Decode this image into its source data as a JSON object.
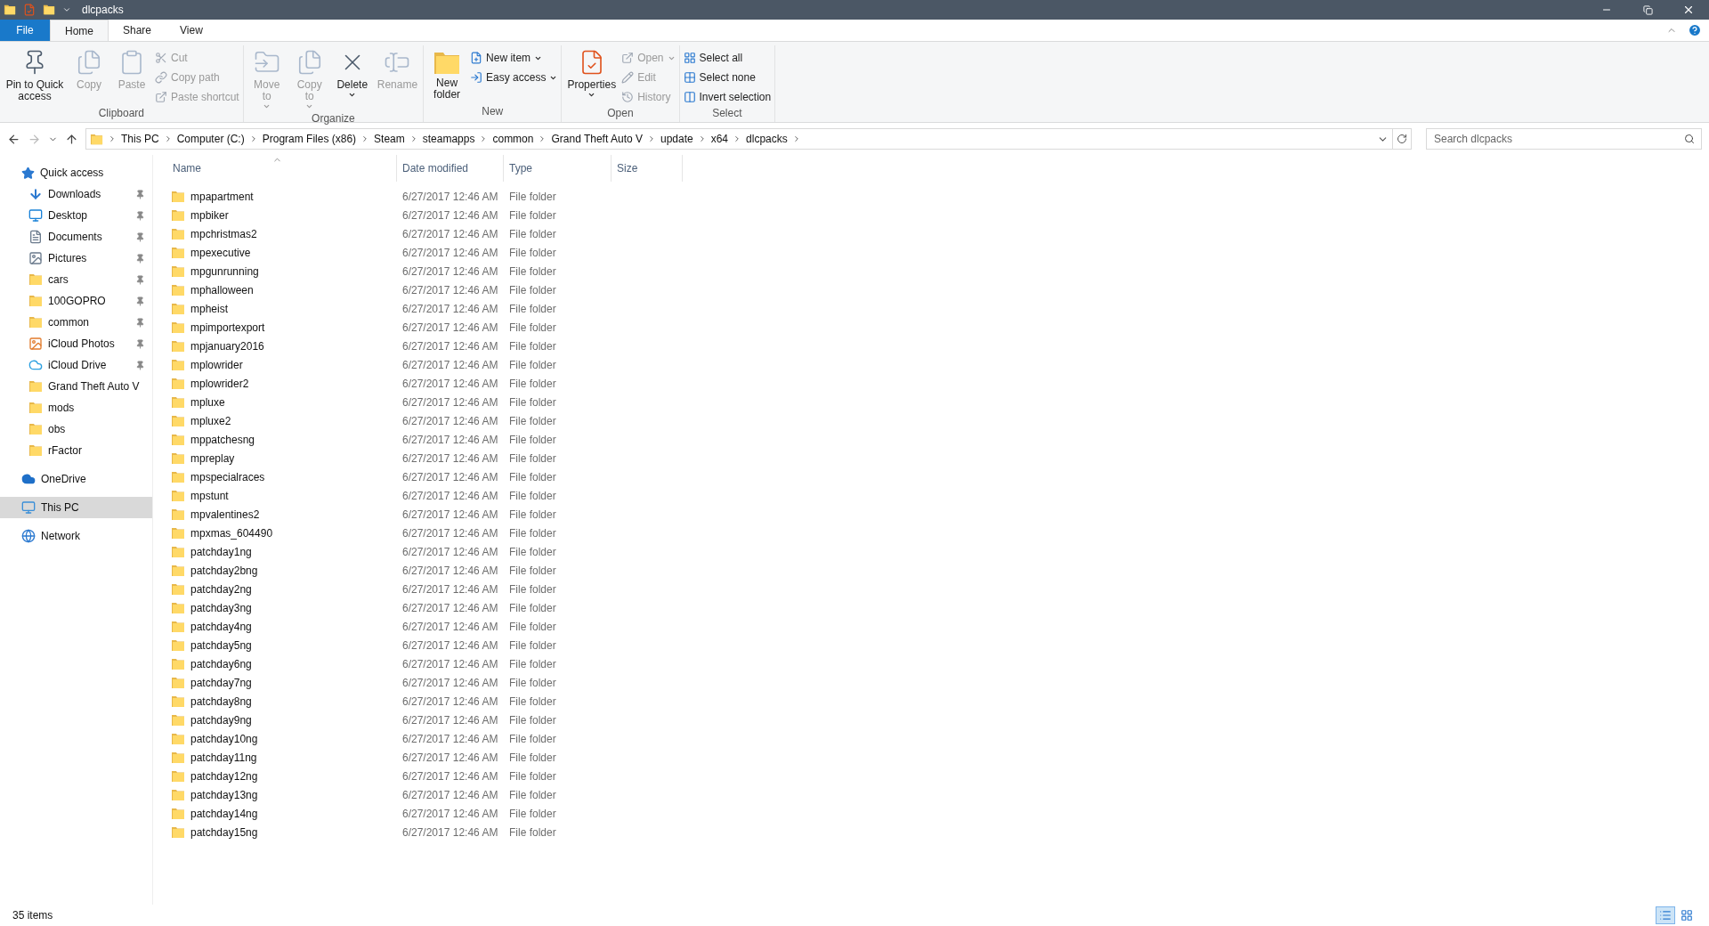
{
  "window": {
    "title": "dlcpacks"
  },
  "ribbon_tabs": [
    {
      "label": "File",
      "kind": "file",
      "selected": false
    },
    {
      "label": "Home",
      "kind": "tab",
      "selected": true
    },
    {
      "label": "Share",
      "kind": "tab",
      "selected": false
    },
    {
      "label": "View",
      "kind": "tab",
      "selected": false
    }
  ],
  "ribbon_groups": [
    {
      "label": "Clipboard",
      "buttons": [
        {
          "label": "Pin to Quick access",
          "kind": "large",
          "disabled": false,
          "dropdown": false
        },
        {
          "label": "Copy",
          "kind": "large",
          "disabled": true,
          "dropdown": false
        },
        {
          "label": "Paste",
          "kind": "large",
          "disabled": true,
          "dropdown": false
        },
        {
          "label": "Cut",
          "kind": "small",
          "disabled": true,
          "dropdown": false
        },
        {
          "label": "Copy path",
          "kind": "small",
          "disabled": true,
          "dropdown": false
        },
        {
          "label": "Paste shortcut",
          "kind": "small",
          "disabled": true,
          "dropdown": false
        }
      ]
    },
    {
      "label": "Organize",
      "buttons": [
        {
          "label": "Move to",
          "kind": "large",
          "disabled": true,
          "dropdown": true
        },
        {
          "label": "Copy to",
          "kind": "large",
          "disabled": true,
          "dropdown": true
        },
        {
          "label": "Delete",
          "kind": "large",
          "disabled": false,
          "dropdown": true
        },
        {
          "label": "Rename",
          "kind": "large",
          "disabled": true,
          "dropdown": false
        }
      ]
    },
    {
      "label": "New",
      "buttons": [
        {
          "label": "New folder",
          "kind": "large",
          "disabled": false,
          "dropdown": false
        },
        {
          "label": "New item",
          "kind": "small",
          "disabled": false,
          "dropdown": true
        },
        {
          "label": "Easy access",
          "kind": "small",
          "disabled": false,
          "dropdown": true
        }
      ]
    },
    {
      "label": "Open",
      "buttons": [
        {
          "label": "Properties",
          "kind": "large",
          "disabled": false,
          "dropdown": true
        },
        {
          "label": "Open",
          "kind": "small",
          "disabled": true,
          "dropdown": true
        },
        {
          "label": "Edit",
          "kind": "small",
          "disabled": true,
          "dropdown": false
        },
        {
          "label": "History",
          "kind": "small",
          "disabled": true,
          "dropdown": false
        }
      ]
    },
    {
      "label": "Select",
      "buttons": [
        {
          "label": "Select all",
          "kind": "small",
          "disabled": false,
          "dropdown": false
        },
        {
          "label": "Select none",
          "kind": "small",
          "disabled": false,
          "dropdown": false
        },
        {
          "label": "Invert selection",
          "kind": "small",
          "disabled": false,
          "dropdown": false
        }
      ]
    }
  ],
  "address": {
    "breadcrumbs": [
      "This PC",
      "Computer (C:)",
      "Program Files (x86)",
      "Steam",
      "steamapps",
      "common",
      "Grand Theft Auto V",
      "update",
      "x64",
      "dlcpacks"
    ],
    "search": {
      "placeholder": "Search dlcpacks"
    }
  },
  "sidebar": [
    {
      "label": "Quick access",
      "kind": "quick",
      "selected": false,
      "children": [
        {
          "label": "Downloads",
          "kind": "downloads",
          "pinned": true,
          "selected": false
        },
        {
          "label": "Desktop",
          "kind": "desktop",
          "pinned": true,
          "selected": false
        },
        {
          "label": "Documents",
          "kind": "documents",
          "pinned": true,
          "selected": false
        },
        {
          "label": "Pictures",
          "kind": "pictures",
          "pinned": true,
          "selected": false
        },
        {
          "label": "cars",
          "kind": "folder",
          "pinned": true,
          "selected": false
        },
        {
          "label": "100GOPRO",
          "kind": "folder",
          "pinned": true,
          "selected": false
        },
        {
          "label": "common",
          "kind": "folder",
          "pinned": true,
          "selected": false
        },
        {
          "label": "iCloud Photos",
          "kind": "photos",
          "pinned": true,
          "selected": false
        },
        {
          "label": "iCloud Drive",
          "kind": "cloud",
          "pinned": true,
          "selected": false
        },
        {
          "label": "Grand Theft Auto V",
          "kind": "folder",
          "pinned": false,
          "selected": false
        },
        {
          "label": "mods",
          "kind": "folder",
          "pinned": false,
          "selected": false
        },
        {
          "label": "obs",
          "kind": "folder",
          "pinned": false,
          "selected": false
        },
        {
          "label": "rFactor",
          "kind": "folder",
          "pinned": false,
          "selected": false
        }
      ]
    },
    {
      "label": "OneDrive",
      "kind": "onedrive",
      "selected": false
    },
    {
      "label": "This PC",
      "kind": "pc",
      "selected": true
    },
    {
      "label": "Network",
      "kind": "network",
      "selected": false
    }
  ],
  "table": {
    "columns": [
      "Name",
      "Date modified",
      "Type",
      "Size"
    ],
    "rows": [
      {
        "name": "mpapartment",
        "date": "6/27/2017 12:46 AM",
        "type": "File folder"
      },
      {
        "name": "mpbiker",
        "date": "6/27/2017 12:46 AM",
        "type": "File folder"
      },
      {
        "name": "mpchristmas2",
        "date": "6/27/2017 12:46 AM",
        "type": "File folder"
      },
      {
        "name": "mpexecutive",
        "date": "6/27/2017 12:46 AM",
        "type": "File folder"
      },
      {
        "name": "mpgunrunning",
        "date": "6/27/2017 12:46 AM",
        "type": "File folder"
      },
      {
        "name": "mphalloween",
        "date": "6/27/2017 12:46 AM",
        "type": "File folder"
      },
      {
        "name": "mpheist",
        "date": "6/27/2017 12:46 AM",
        "type": "File folder"
      },
      {
        "name": "mpimportexport",
        "date": "6/27/2017 12:46 AM",
        "type": "File folder"
      },
      {
        "name": "mpjanuary2016",
        "date": "6/27/2017 12:46 AM",
        "type": "File folder"
      },
      {
        "name": "mplowrider",
        "date": "6/27/2017 12:46 AM",
        "type": "File folder"
      },
      {
        "name": "mplowrider2",
        "date": "6/27/2017 12:46 AM",
        "type": "File folder"
      },
      {
        "name": "mpluxe",
        "date": "6/27/2017 12:46 AM",
        "type": "File folder"
      },
      {
        "name": "mpluxe2",
        "date": "6/27/2017 12:46 AM",
        "type": "File folder"
      },
      {
        "name": "mppatchesng",
        "date": "6/27/2017 12:46 AM",
        "type": "File folder"
      },
      {
        "name": "mpreplay",
        "date": "6/27/2017 12:46 AM",
        "type": "File folder"
      },
      {
        "name": "mpspecialraces",
        "date": "6/27/2017 12:46 AM",
        "type": "File folder"
      },
      {
        "name": "mpstunt",
        "date": "6/27/2017 12:46 AM",
        "type": "File folder"
      },
      {
        "name": "mpvalentines2",
        "date": "6/27/2017 12:46 AM",
        "type": "File folder"
      },
      {
        "name": "mpxmas_604490",
        "date": "6/27/2017 12:46 AM",
        "type": "File folder"
      },
      {
        "name": "patchday1ng",
        "date": "6/27/2017 12:46 AM",
        "type": "File folder"
      },
      {
        "name": "patchday2bng",
        "date": "6/27/2017 12:46 AM",
        "type": "File folder"
      },
      {
        "name": "patchday2ng",
        "date": "6/27/2017 12:46 AM",
        "type": "File folder"
      },
      {
        "name": "patchday3ng",
        "date": "6/27/2017 12:46 AM",
        "type": "File folder"
      },
      {
        "name": "patchday4ng",
        "date": "6/27/2017 12:46 AM",
        "type": "File folder"
      },
      {
        "name": "patchday5ng",
        "date": "6/27/2017 12:46 AM",
        "type": "File folder"
      },
      {
        "name": "patchday6ng",
        "date": "6/27/2017 12:46 AM",
        "type": "File folder"
      },
      {
        "name": "patchday7ng",
        "date": "6/27/2017 12:46 AM",
        "type": "File folder"
      },
      {
        "name": "patchday8ng",
        "date": "6/27/2017 12:46 AM",
        "type": "File folder"
      },
      {
        "name": "patchday9ng",
        "date": "6/27/2017 12:46 AM",
        "type": "File folder"
      },
      {
        "name": "patchday10ng",
        "date": "6/27/2017 12:46 AM",
        "type": "File folder"
      },
      {
        "name": "patchday11ng",
        "date": "6/27/2017 12:46 AM",
        "type": "File folder"
      },
      {
        "name": "patchday12ng",
        "date": "6/27/2017 12:46 AM",
        "type": "File folder"
      },
      {
        "name": "patchday13ng",
        "date": "6/27/2017 12:46 AM",
        "type": "File folder"
      },
      {
        "name": "patchday14ng",
        "date": "6/27/2017 12:46 AM",
        "type": "File folder"
      },
      {
        "name": "patchday15ng",
        "date": "6/27/2017 12:46 AM",
        "type": "File folder"
      }
    ]
  },
  "status_bar": {
    "count": "35 items",
    "views": [
      {
        "kind": "details",
        "selected": true
      },
      {
        "kind": "tiles",
        "selected": false
      }
    ]
  }
}
